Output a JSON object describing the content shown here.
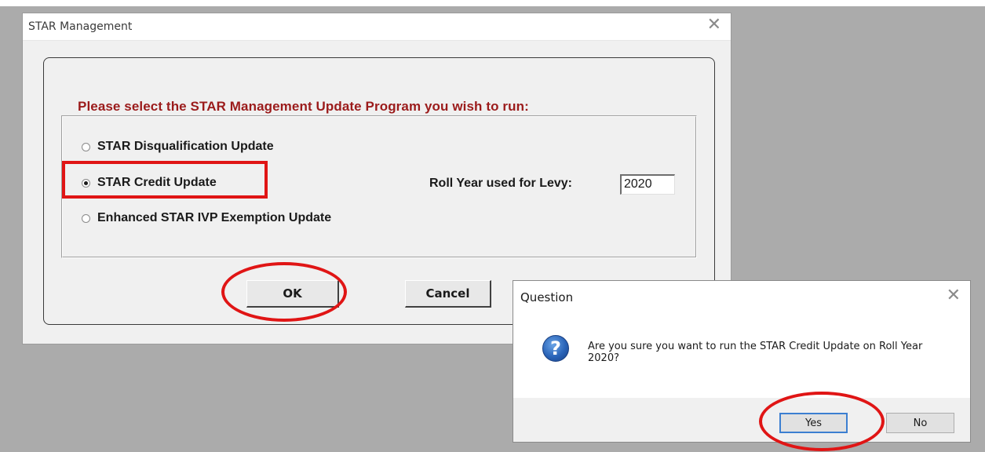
{
  "main_window": {
    "title": "STAR Management",
    "prompt": "Please select the STAR Management Update Program you wish to run:",
    "options": [
      {
        "label": "STAR Disqualification Update",
        "selected": false
      },
      {
        "label": "STAR Credit Update",
        "selected": true
      },
      {
        "label": "Enhanced STAR IVP Exemption Update",
        "selected": false
      }
    ],
    "roll_year_label": "Roll Year used for Levy:",
    "roll_year_value": "2020",
    "ok_label": "OK",
    "cancel_label": "Cancel"
  },
  "dialog": {
    "title": "Question",
    "message": "Are you sure you want to run the STAR Credit Update on Roll Year 2020?",
    "icon": "question-icon",
    "yes_label": "Yes",
    "no_label": "No"
  },
  "colors": {
    "prompt_text": "#9b1b1b",
    "annotation": "#e01515",
    "desktop": "#ababab"
  }
}
